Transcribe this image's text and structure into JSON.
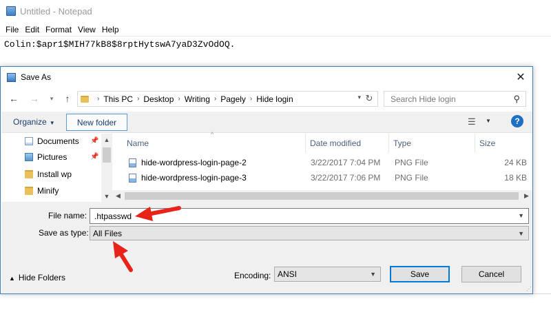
{
  "notepad": {
    "title": "Untitled - Notepad",
    "menu": [
      "File",
      "Edit",
      "Format",
      "View",
      "Help"
    ],
    "content": "Colin:$apr1$MIH77kB8$8rptHytswA7yaD3ZvOdOQ."
  },
  "dialog": {
    "title": "Save As",
    "close_glyph": "✕",
    "address": {
      "crumbs": [
        "This PC",
        "Desktop",
        "Writing",
        "Pagely",
        "Hide login"
      ]
    },
    "search": {
      "placeholder": "Search Hide login"
    },
    "toolbar": {
      "organize_label": "Organize",
      "new_folder_label": "New folder",
      "help_glyph": "?"
    },
    "nav_pane": {
      "items": [
        {
          "label": "Documents",
          "icon": "documents-icon",
          "pinned": true
        },
        {
          "label": "Pictures",
          "icon": "pictures-icon",
          "pinned": true
        },
        {
          "label": "Install wp",
          "icon": "folder-icon",
          "pinned": false
        },
        {
          "label": "Minify",
          "icon": "folder-icon",
          "pinned": false
        }
      ]
    },
    "file_list": {
      "columns": [
        "Name",
        "Date modified",
        "Type",
        "Size"
      ],
      "rows": [
        {
          "name": "hide-wordpress-login-page-2",
          "date": "3/22/2017 7:04 PM",
          "type": "PNG File",
          "size": "24 KB"
        },
        {
          "name": "hide-wordpress-login-page-3",
          "date": "3/22/2017 7:06 PM",
          "type": "PNG File",
          "size": "18 KB"
        }
      ]
    },
    "form": {
      "file_name_label": "File name:",
      "file_name_value": ".htpasswd",
      "save_type_label": "Save as type:",
      "save_type_value": "All Files",
      "encoding_label": "Encoding:",
      "encoding_value": "ANSI",
      "hide_folders_label": "Hide Folders",
      "save_label": "Save",
      "cancel_label": "Cancel"
    }
  },
  "colors": {
    "accent_blue": "#0078d7",
    "dialog_border": "#3c7ebd",
    "annotation_red": "#e8231a",
    "folder_yellow": "#e8c15b"
  }
}
